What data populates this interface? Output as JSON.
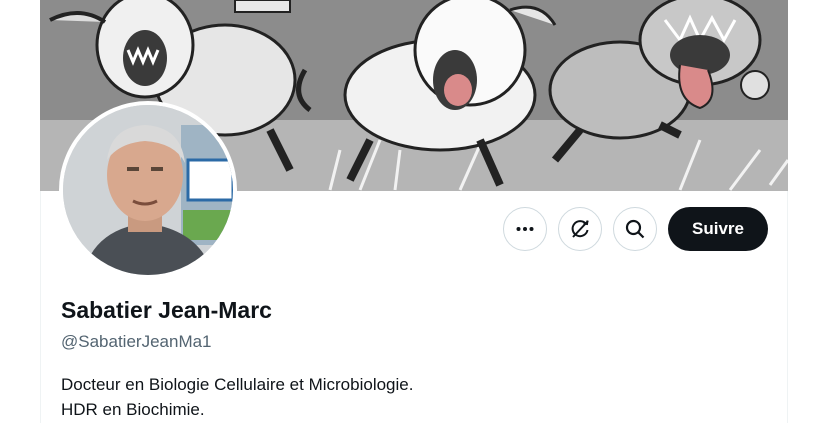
{
  "profile": {
    "display_name": "Sabatier Jean-Marc",
    "handle": "@SabatierJeanMa1",
    "bio_lines": [
      "Docteur en Biologie Cellulaire et Microbiologie.",
      "HDR en Biochimie."
    ]
  },
  "actions": {
    "more_icon": "more-horizontal-icon",
    "notify_icon": "notifications-off-icon",
    "search_icon": "search-icon",
    "follow_label": "Suivre"
  },
  "colors": {
    "follow_bg": "#0f1419",
    "follow_text": "#ffffff",
    "secondary_text": "#536471",
    "border": "#cfd9de"
  }
}
